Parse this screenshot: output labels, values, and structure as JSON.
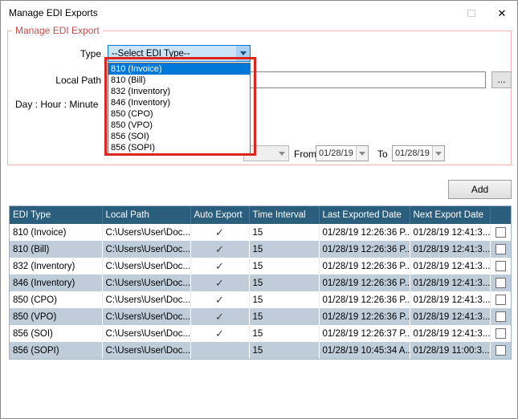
{
  "window": {
    "title": "Manage EDI Exports",
    "close": "✕"
  },
  "form": {
    "group_title": "Manage EDI Export",
    "type_label": "Type",
    "type_value": "--Select EDI Type--",
    "local_path_label": "Local Path",
    "browse_label": "...",
    "schedule_label": "Day : Hour : Minute",
    "from_label": "From",
    "from_value": "01/28/19",
    "to_label": "To",
    "to_value": "01/28/19",
    "add_label": "Add"
  },
  "dropdown": {
    "selected_index": 0,
    "items": [
      "810 (Invoice)",
      "810 (Bill)",
      "832 (Inventory)",
      "846 (Inventory)",
      "850 (CPO)",
      "850 (VPO)",
      "856 (SOI)",
      "856 (SOPI)"
    ]
  },
  "table": {
    "headers": [
      "EDI Type",
      "Local Path",
      "Auto Export",
      "Time Interval",
      "Last Exported Date",
      "Next Export Date",
      ""
    ],
    "check_glyph": "✓",
    "rows": [
      {
        "edi_type": "810 (Invoice)",
        "local_path": "C:\\Users\\User\\Doc...",
        "auto_export": true,
        "time_interval": "15",
        "last_exported_date": "01/28/19 12:26:36 P...",
        "next_export_date": "01/28/19 12:41:3...",
        "checked": false
      },
      {
        "edi_type": "810 (Bill)",
        "local_path": "C:\\Users\\User\\Doc...",
        "auto_export": true,
        "time_interval": "15",
        "last_exported_date": "01/28/19 12:26:36 P...",
        "next_export_date": "01/28/19 12:41:3...",
        "checked": false
      },
      {
        "edi_type": "832 (Inventory)",
        "local_path": "C:\\Users\\User\\Doc...",
        "auto_export": true,
        "time_interval": "15",
        "last_exported_date": "01/28/19 12:26:36 P...",
        "next_export_date": "01/28/19 12:41:3...",
        "checked": false
      },
      {
        "edi_type": "846 (Inventory)",
        "local_path": "C:\\Users\\User\\Doc...",
        "auto_export": true,
        "time_interval": "15",
        "last_exported_date": "01/28/19 12:26:36 P...",
        "next_export_date": "01/28/19 12:41:3...",
        "checked": false
      },
      {
        "edi_type": "850 (CPO)",
        "local_path": "C:\\Users\\User\\Doc...",
        "auto_export": true,
        "time_interval": "15",
        "last_exported_date": "01/28/19 12:26:36 P...",
        "next_export_date": "01/28/19 12:41:3...",
        "checked": false
      },
      {
        "edi_type": "850 (VPO)",
        "local_path": "C:\\Users\\User\\Doc...",
        "auto_export": true,
        "time_interval": "15",
        "last_exported_date": "01/28/19 12:26:36 P...",
        "next_export_date": "01/28/19 12:41:3...",
        "checked": false
      },
      {
        "edi_type": "856 (SOI)",
        "local_path": "C:\\Users\\User\\Doc...",
        "auto_export": true,
        "time_interval": "15",
        "last_exported_date": "01/28/19 12:26:37 P...",
        "next_export_date": "01/28/19 12:41:3...",
        "checked": false
      },
      {
        "edi_type": "856 (SOPI)",
        "local_path": "C:\\Users\\User\\Doc...",
        "auto_export": false,
        "time_interval": "15",
        "last_exported_date": "01/28/19 10:45:34 A...",
        "next_export_date": "01/28/19 11:00:3...",
        "checked": false
      }
    ]
  },
  "colors": {
    "grid_header_bg": "#2B5D7D",
    "grid_alt_row_bg": "#BFCDDA",
    "selection_blue": "#0078D7",
    "annotation_red": "#DF241B",
    "group_title_red": "#C0504D"
  }
}
